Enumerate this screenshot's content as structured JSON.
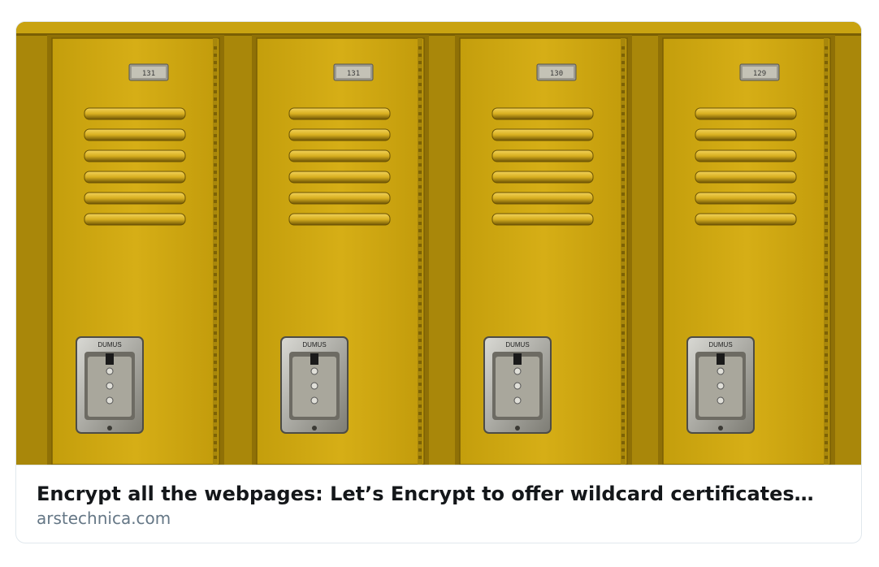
{
  "card": {
    "title": "Encrypt all the webpages: Let’s Encrypt to offer wildcard certificates…",
    "domain": "arstechnica.com"
  },
  "image": {
    "lockers": [
      {
        "number": "131",
        "brand": "DUMUS"
      },
      {
        "number": "131",
        "brand": "DUMUS"
      },
      {
        "number": "130",
        "brand": "DUMUS"
      },
      {
        "number": "129",
        "brand": "DUMUS"
      }
    ]
  },
  "colors": {
    "locker_yellow": "#d0a812",
    "locker_shadow": "#8a6d05",
    "title_text": "#14171a",
    "domain_text": "#657786",
    "border": "#e1e8ed"
  }
}
